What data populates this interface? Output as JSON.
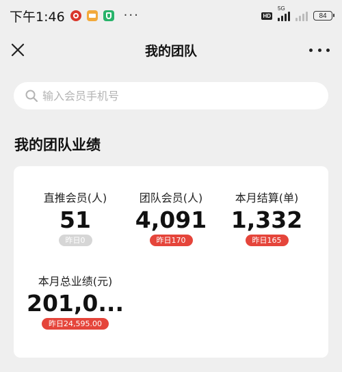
{
  "status_bar": {
    "time": "下午1:46",
    "network_label": "5G",
    "hd_label": "HD",
    "battery": "84",
    "more_dots": "···"
  },
  "nav": {
    "title": "我的团队"
  },
  "search": {
    "placeholder": "输入会员手机号",
    "value": ""
  },
  "section": {
    "title": "我的团队业绩"
  },
  "stats": [
    {
      "label": "直推会员(人)",
      "value": "51",
      "badge": "昨日0",
      "badge_style": "grey"
    },
    {
      "label": "团队会员(人)",
      "value": "4,091",
      "badge": "昨日170",
      "badge_style": "red"
    },
    {
      "label": "本月结算(单)",
      "value": "1,332",
      "badge": "昨日165",
      "badge_style": "red"
    },
    {
      "label": "本月总业绩(元)",
      "value": "201,0...",
      "badge": "昨日24,595.00",
      "badge_style": "red"
    }
  ],
  "colors": {
    "accent_red": "#e5453b",
    "badge_grey": "#d6d6d6",
    "page_bg": "#efefef",
    "card_bg": "#ffffff"
  }
}
